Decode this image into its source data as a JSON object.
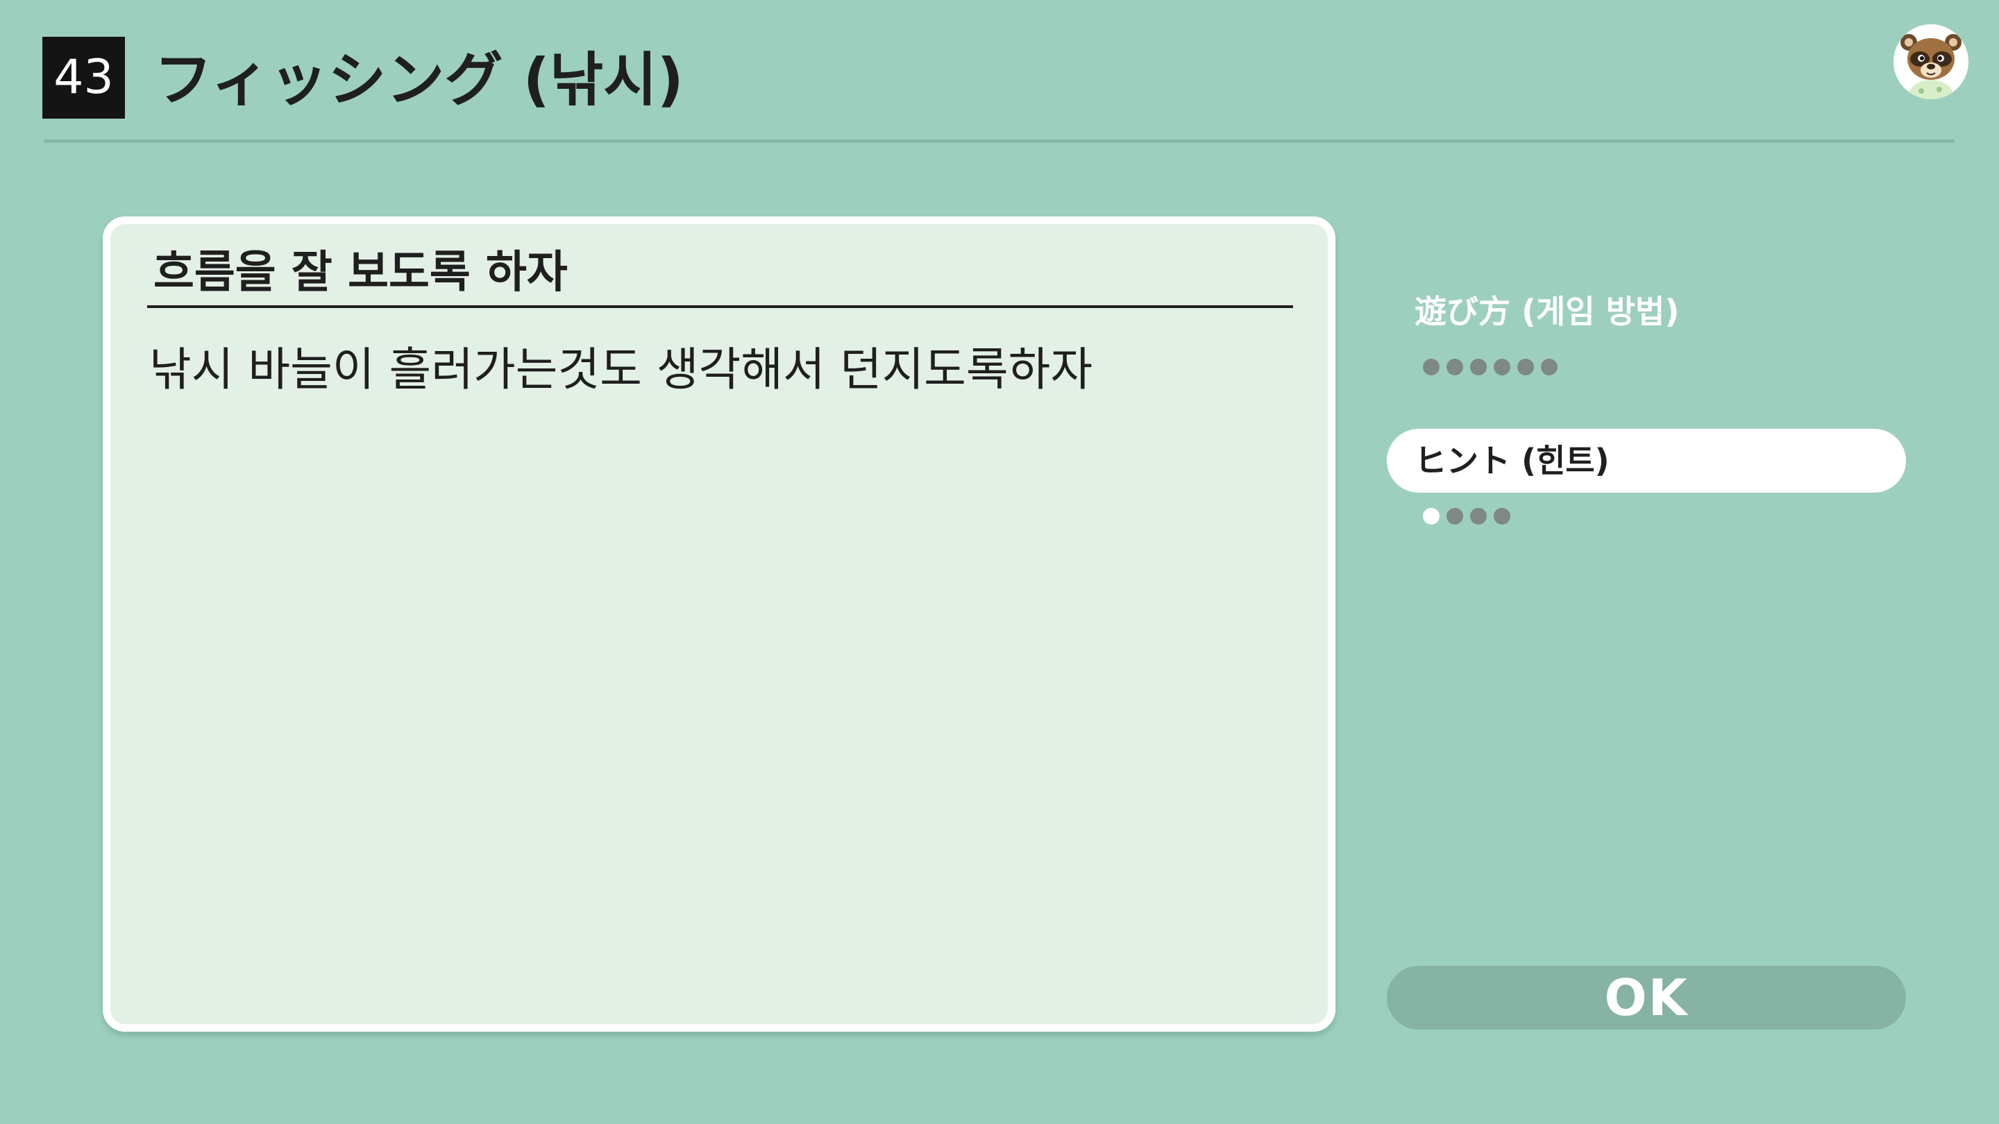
{
  "header": {
    "number": "43",
    "title": "フィッシング (낚시)"
  },
  "avatar": {
    "icon": "tom-nook-avatar-icon"
  },
  "panel": {
    "heading": "흐름을 잘 보도록 하자",
    "body": "낚시 바늘이 흘러가는것도 생각해서 던지도록하자"
  },
  "sidebar": {
    "items": [
      {
        "label": "遊び方 (게임 방법)",
        "page_count": 6,
        "current_page": null,
        "selected": false
      },
      {
        "label": "ヒント (힌트)",
        "page_count": 4,
        "current_page": 1,
        "selected": true
      }
    ]
  },
  "ok_button": {
    "label": "OK"
  },
  "colors": {
    "background": "#9dcfbe",
    "panel": "#e3f0e6",
    "panel_border": "#ffffff",
    "badge": "#141414",
    "ok_button": "#86b3a4",
    "dot_inactive": "#7e8884",
    "dot_active": "#ffffff"
  }
}
